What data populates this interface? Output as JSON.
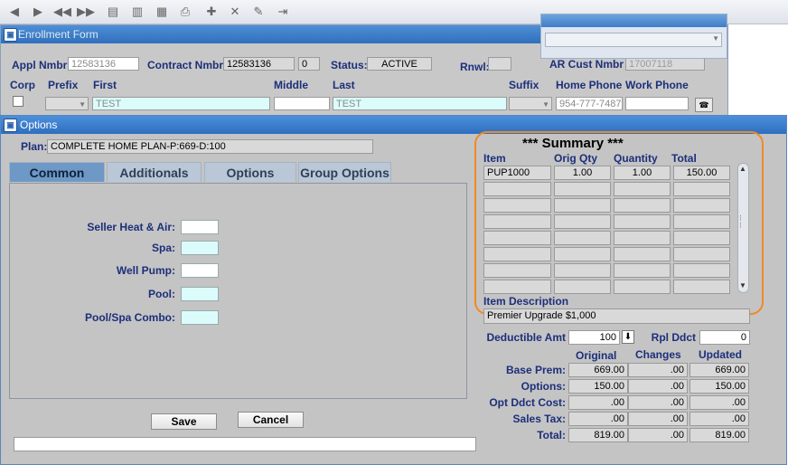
{
  "toolbar": {
    "icons": [
      "first-icon",
      "previous-icon",
      "previous-page-icon",
      "next-page-icon",
      "query-icon",
      "query-execute-icon",
      "list-icon",
      "print-icon",
      "insert-record-icon",
      "delete-record-icon",
      "clear-icon",
      "exit-icon"
    ]
  },
  "enrollment": {
    "title": "Enrollment Form",
    "appl_nmbr_label": "Appl Nmbr",
    "appl_nmbr": "12583136",
    "contract_nmbr_label": "Contract Nmbr",
    "contract_nmbr": "12583136",
    "contract_seq": "0",
    "status_label": "Status:",
    "status": "ACTIVE",
    "rnwl_label": "Rnwl:",
    "ar_cust_label": "AR Cust Nmbr",
    "ar_cust": "17007118",
    "corp_label": "Corp",
    "prefix_label": "Prefix",
    "first_label": "First",
    "first": "TEST",
    "middle_label": "Middle",
    "middle": "",
    "last_label": "Last",
    "last": "TEST",
    "suffix_label": "Suffix",
    "home_phone_label": "Home Phone",
    "home_phone": "954-777-7487",
    "work_phone_label": "Work Phone",
    "work_phone": ""
  },
  "options": {
    "title": "Options",
    "plan_label": "Plan:",
    "plan": "COMPLETE HOME PLAN-P:669-D:100",
    "tabs": [
      "Common",
      "Additionals",
      "Options",
      "Group Options"
    ],
    "active_tab": "Common",
    "common_fields": [
      {
        "label": "Seller Heat & Air:",
        "value": ""
      },
      {
        "label": "Spa:",
        "value": ""
      },
      {
        "label": "Well Pump:",
        "value": ""
      },
      {
        "label": "Pool:",
        "value": ""
      },
      {
        "label": "Pool/Spa Combo:",
        "value": ""
      }
    ],
    "save_label": "Save",
    "cancel_label": "Cancel",
    "status_line": ""
  },
  "summary": {
    "title": "*** Summary ***",
    "headers": [
      "Item",
      "Orig Qty",
      "Quantity",
      "Total"
    ],
    "rows": [
      {
        "item": "PUP1000",
        "orig_qty": "1.00",
        "quantity": "1.00",
        "total": "150.00"
      },
      {
        "item": "",
        "orig_qty": "",
        "quantity": "",
        "total": ""
      },
      {
        "item": "",
        "orig_qty": "",
        "quantity": "",
        "total": ""
      },
      {
        "item": "",
        "orig_qty": "",
        "quantity": "",
        "total": ""
      },
      {
        "item": "",
        "orig_qty": "",
        "quantity": "",
        "total": ""
      },
      {
        "item": "",
        "orig_qty": "",
        "quantity": "",
        "total": ""
      },
      {
        "item": "",
        "orig_qty": "",
        "quantity": "",
        "total": ""
      },
      {
        "item": "",
        "orig_qty": "",
        "quantity": "",
        "total": ""
      }
    ],
    "item_desc_label": "Item Description",
    "item_desc": "Premier Upgrade $1,000"
  },
  "premium": {
    "deductible_label": "Deductible Amt",
    "deductible": "100",
    "rpl_ddct_label": "Rpl Ddct",
    "rpl_ddct": "0",
    "col_headers": [
      "Original",
      "Changes",
      "Updated"
    ],
    "rows": [
      {
        "label": "Base Prem:",
        "original": "669.00",
        "changes": ".00",
        "updated": "669.00"
      },
      {
        "label": "Options:",
        "original": "150.00",
        "changes": ".00",
        "updated": "150.00"
      },
      {
        "label": "Opt Ddct Cost:",
        "original": ".00",
        "changes": ".00",
        "updated": ".00"
      },
      {
        "label": "Sales Tax:",
        "original": ".00",
        "changes": ".00",
        "updated": ".00"
      },
      {
        "label": "Total:",
        "original": "819.00",
        "changes": ".00",
        "updated": "819.00"
      }
    ]
  },
  "colors": {
    "title_bar": "#2f6fbd",
    "label_blue": "#1c2f7a",
    "highlight": "#f08a24",
    "cyan_field": "#dcfcfc"
  }
}
